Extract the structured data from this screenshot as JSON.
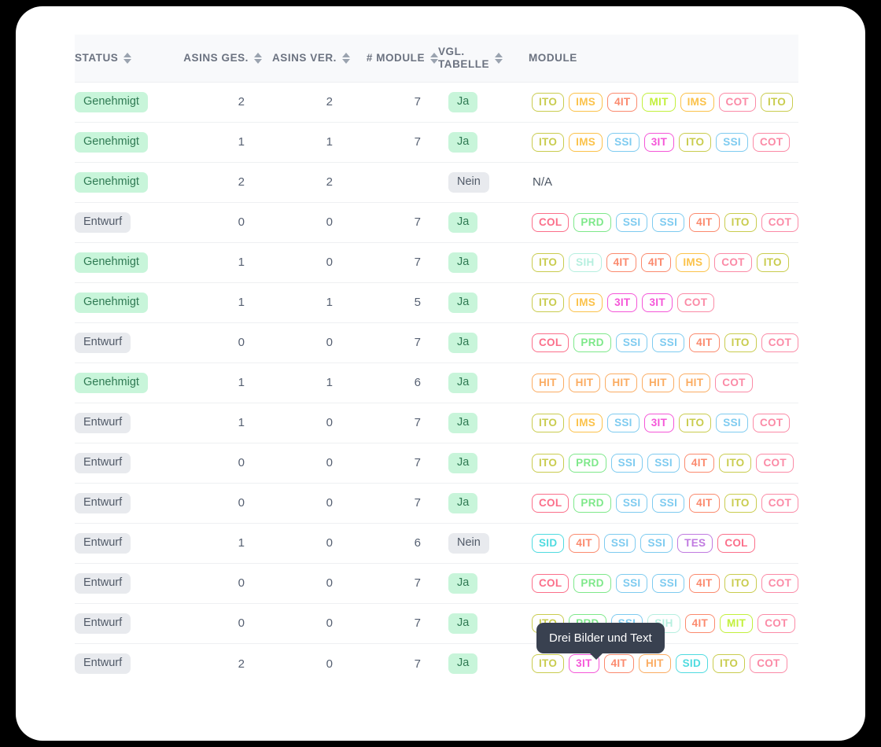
{
  "card": {
    "background": "#ffffff"
  },
  "table": {
    "columns": [
      {
        "label": "STATUS",
        "sortable": true,
        "align": "left"
      },
      {
        "label": "ASINS GES.",
        "sortable": true,
        "align": "right"
      },
      {
        "label": "ASINS VER.",
        "sortable": true,
        "align": "right"
      },
      {
        "label": "# MODULE",
        "sortable": true,
        "align": "right"
      },
      {
        "label": "VGL.\nTABELLE",
        "sortable": true,
        "align": "left"
      },
      {
        "label": "MODULE",
        "sortable": false,
        "align": "left"
      }
    ],
    "rows": [
      {
        "status": "Genehmigt",
        "status_style": "green",
        "asins_ges": "2",
        "asins_ver": "2",
        "module_count": "7",
        "vgl": "Ja",
        "vgl_style": "green",
        "modules": [
          "ITO",
          "IMS",
          "4IT",
          "MIT",
          "IMS",
          "COT",
          "ITO"
        ]
      },
      {
        "status": "Genehmigt",
        "status_style": "green",
        "asins_ges": "1",
        "asins_ver": "1",
        "module_count": "7",
        "vgl": "Ja",
        "vgl_style": "green",
        "modules": [
          "ITO",
          "IMS",
          "SSI",
          "3IT",
          "ITO",
          "SSI",
          "COT"
        ]
      },
      {
        "status": "Genehmigt",
        "status_style": "green",
        "asins_ges": "2",
        "asins_ver": "2",
        "module_count": "",
        "vgl": "Nein",
        "vgl_style": "gray",
        "modules": [],
        "modules_text": "N/A"
      },
      {
        "status": "Entwurf",
        "status_style": "gray",
        "asins_ges": "0",
        "asins_ver": "0",
        "module_count": "7",
        "vgl": "Ja",
        "vgl_style": "green",
        "modules": [
          "COL",
          "PRD",
          "SSI",
          "SSI",
          "4IT",
          "ITO",
          "COT"
        ]
      },
      {
        "status": "Genehmigt",
        "status_style": "green",
        "asins_ges": "1",
        "asins_ver": "0",
        "module_count": "7",
        "vgl": "Ja",
        "vgl_style": "green",
        "modules": [
          "ITO",
          "SIH",
          "4IT",
          "4IT",
          "IMS",
          "COT",
          "ITO"
        ]
      },
      {
        "status": "Genehmigt",
        "status_style": "green",
        "asins_ges": "1",
        "asins_ver": "1",
        "module_count": "5",
        "vgl": "Ja",
        "vgl_style": "green",
        "modules": [
          "ITO",
          "IMS",
          "3IT",
          "3IT",
          "COT"
        ]
      },
      {
        "status": "Entwurf",
        "status_style": "gray",
        "asins_ges": "0",
        "asins_ver": "0",
        "module_count": "7",
        "vgl": "Ja",
        "vgl_style": "green",
        "modules": [
          "COL",
          "PRD",
          "SSI",
          "SSI",
          "4IT",
          "ITO",
          "COT"
        ]
      },
      {
        "status": "Genehmigt",
        "status_style": "green",
        "asins_ges": "1",
        "asins_ver": "1",
        "module_count": "6",
        "vgl": "Ja",
        "vgl_style": "green",
        "modules": [
          "HIT",
          "HIT",
          "HIT",
          "HIT",
          "HIT",
          "COT"
        ]
      },
      {
        "status": "Entwurf",
        "status_style": "gray",
        "asins_ges": "1",
        "asins_ver": "0",
        "module_count": "7",
        "vgl": "Ja",
        "vgl_style": "green",
        "modules": [
          "ITO",
          "IMS",
          "SSI",
          "3IT",
          "ITO",
          "SSI",
          "COT"
        ]
      },
      {
        "status": "Entwurf",
        "status_style": "gray",
        "asins_ges": "0",
        "asins_ver": "0",
        "module_count": "7",
        "vgl": "Ja",
        "vgl_style": "green",
        "modules": [
          "ITO",
          "PRD",
          "SSI",
          "SSI",
          "4IT",
          "ITO",
          "COT"
        ]
      },
      {
        "status": "Entwurf",
        "status_style": "gray",
        "asins_ges": "0",
        "asins_ver": "0",
        "module_count": "7",
        "vgl": "Ja",
        "vgl_style": "green",
        "modules": [
          "COL",
          "PRD",
          "SSI",
          "SSI",
          "4IT",
          "ITO",
          "COT"
        ]
      },
      {
        "status": "Entwurf",
        "status_style": "gray",
        "asins_ges": "1",
        "asins_ver": "0",
        "module_count": "6",
        "vgl": "Nein",
        "vgl_style": "gray",
        "modules": [
          "SID",
          "4IT",
          "SSI",
          "SSI",
          "TES",
          "COL"
        ]
      },
      {
        "status": "Entwurf",
        "status_style": "gray",
        "asins_ges": "0",
        "asins_ver": "0",
        "module_count": "7",
        "vgl": "Ja",
        "vgl_style": "green",
        "modules": [
          "COL",
          "PRD",
          "SSI",
          "SSI",
          "4IT",
          "ITO",
          "COT"
        ]
      },
      {
        "status": "Entwurf",
        "status_style": "gray",
        "asins_ges": "0",
        "asins_ver": "0",
        "module_count": "7",
        "vgl": "Ja",
        "vgl_style": "green",
        "modules": [
          "ITO",
          "PRD",
          "SSI",
          "SIH",
          "4IT",
          "MIT",
          "COT"
        ]
      },
      {
        "status": "Entwurf",
        "status_style": "gray",
        "asins_ges": "2",
        "asins_ver": "0",
        "module_count": "7",
        "vgl": "Ja",
        "vgl_style": "green",
        "modules": [
          "ITO",
          "3IT",
          "4IT",
          "HIT",
          "SID",
          "ITO",
          "COT"
        ]
      }
    ]
  },
  "tooltip": {
    "text": "Drei Bilder und Text"
  },
  "tag_colors": {
    "ITO": "#c9cc4e",
    "IMS": "#fbc24a",
    "4IT": "#fb8a6e",
    "MIT": "#c2f03c",
    "COT": "#fb8aa6",
    "SSI": "#7ecbf0",
    "3IT": "#f556d8",
    "COL": "#fb6f8a",
    "PRD": "#7ee88a",
    "SIH": "#b6efdf",
    "HIT": "#fbac62",
    "SID": "#4fdbe0",
    "TES": "#c07ae0"
  },
  "badge_colors": {
    "green_bg": "#c8f5da",
    "green_fg": "#2f7a53",
    "gray_bg": "#e8eaee",
    "gray_fg": "#515a68"
  },
  "tooltip_color": "#394150"
}
